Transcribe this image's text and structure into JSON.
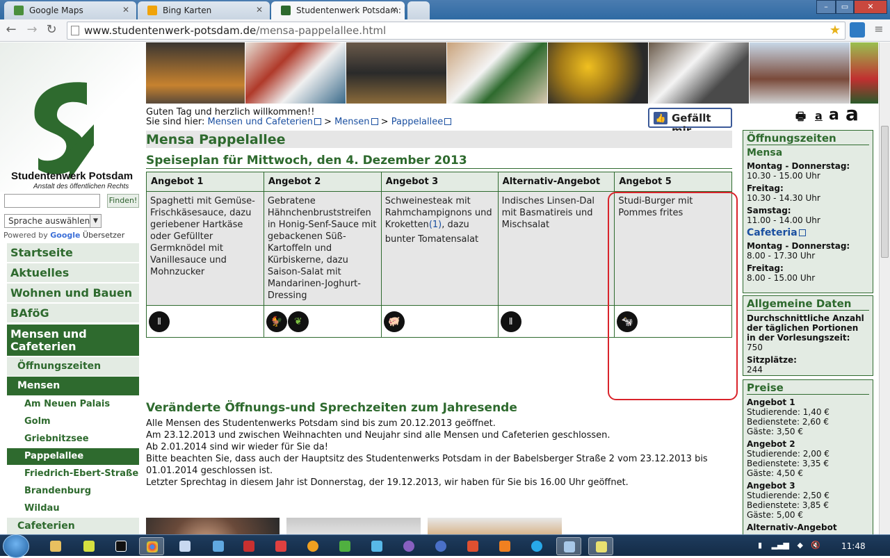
{
  "browser": {
    "tabs": [
      {
        "title": "Google Maps",
        "active": false,
        "favicon_color": "#4a8f3c"
      },
      {
        "title": "Bing Karten",
        "active": false,
        "favicon_color": "#f0a30a"
      },
      {
        "title": "Studentenwerk Potsdam: M",
        "active": true,
        "favicon_color": "#2e6a2e"
      }
    ],
    "url_host": "www.studentenwerk-potsdam.de",
    "url_path": "/mensa-pappelallee.html",
    "controls": {
      "minimize": "–",
      "maximize": "▭",
      "close": "✕"
    }
  },
  "sidebar": {
    "brand": "Studentenwerk Potsdam",
    "brand_sub": "Anstalt des öffentlichen Rechts",
    "search_button": "Finden!",
    "search_value": "",
    "language_select": "Sprache auswählen",
    "powered_by": "Powered by",
    "google": "Google",
    "translator": "Übersetzer",
    "main_nav": [
      {
        "label": "Startseite",
        "active": false
      },
      {
        "label": "Aktuelles",
        "active": false
      },
      {
        "label": "Wohnen und Bauen",
        "active": false
      },
      {
        "label": "BAföG",
        "active": false
      },
      {
        "label": "Mensen und Cafeterien",
        "active": true
      }
    ],
    "sub_nav": [
      {
        "label": "Öffnungszeiten",
        "active": false
      },
      {
        "label": "Mensen",
        "active": true
      }
    ],
    "mensen_nav": [
      {
        "label": "Am Neuen Palais",
        "active": false
      },
      {
        "label": "Golm",
        "active": false
      },
      {
        "label": "Griebnitzsee",
        "active": false
      },
      {
        "label": "Pappelallee",
        "active": true
      },
      {
        "label": "Friedrich-Ebert-Straße",
        "active": false
      },
      {
        "label": "Brandenburg",
        "active": false
      },
      {
        "label": "Wildau",
        "active": false
      }
    ],
    "cafeterien": "Cafeterien"
  },
  "main": {
    "greeting": "Guten Tag und herzlich willkommen!!",
    "breadcrumb_prefix": "Sie sind hier:",
    "breadcrumb": [
      "Mensen und Cafeterien",
      "Mensen",
      "Pappelallee"
    ],
    "breadcrumb_sep": ">",
    "like_button": "Gefällt mir",
    "page_title": "Mensa Pappelallee",
    "menu_heading": "Speiseplan für Mittwoch, den 4. Dezember 2013",
    "menu": [
      {
        "header": "Angebot 1",
        "description": "Spaghetti mit Gemüse-Frischkäsesauce, dazu geriebener Hartkäse oder Gefüllter Germknödel mit Vanillesauce und Mohnzucker",
        "icons": [
          "vegetarian-icon"
        ]
      },
      {
        "header": "Angebot 2",
        "description": "Gebratene Hähnchenbruststreifen in Honig-Senf-Sauce mit gebackenen Süß-Kartoffeln und Kürbiskerne, dazu Saison-Salat mit Mandarinen-Joghurt-Dressing",
        "icons": [
          "poultry-icon",
          "vegan-icon"
        ]
      },
      {
        "header": "Angebot 3",
        "description": "Schweinesteak mit Rahmchampignons und Kroketten",
        "ref": "(1)",
        "description_after": ", dazu",
        "description_2": "bunter Tomatensalat",
        "icons": [
          "pork-icon"
        ]
      },
      {
        "header": "Alternativ-Angebot",
        "description": "Indisches Linsen-Dal mit Basmatireis und Mischsalat",
        "icons": [
          "vegetarian-icon"
        ]
      },
      {
        "header": "Angebot 5",
        "description": "Studi-Burger mit Pommes frites",
        "icons": [
          "beef-icon"
        ]
      }
    ],
    "notice_title": "Veränderte Öffnungs-und Sprechzeiten zum Jahresende",
    "notice_lines": [
      "Alle Mensen des Studentenwerks Potsdam sind bis zum 20.12.2013 geöffnet.",
      "Am 23.12.2013 und zwischen Weihnachten und Neujahr sind alle Mensen und Cafeterien geschlossen.",
      "Ab 2.01.2014 sind wir wieder für Sie da!",
      "Bitte beachten Sie, dass auch der Hauptsitz des Studentenwerks Potsdam in der Babelsberger Straße 2 vom 23.12.2013 bis 01.01.2014 geschlossen ist.",
      "Letzter Sprechtag in diesem Jahr ist Donnerstag, der 19.12.2013, wir haben für Sie bis 16.00 Uhr geöffnet."
    ]
  },
  "right": {
    "font_tools": [
      "a",
      "a",
      "a"
    ],
    "hours_title": "Öffnungszeiten",
    "mensa_label": "Mensa",
    "mensa_hours": [
      {
        "day": "Montag - Donnerstag:",
        "time": "10.30 - 15.00 Uhr"
      },
      {
        "day": "Freitag:",
        "time": "10.30 - 14.30 Uhr"
      },
      {
        "day": "Samstag:",
        "time": "11.00 - 14.00 Uhr"
      }
    ],
    "cafeteria_label": "Cafeteria",
    "cafeteria_hours": [
      {
        "day": "Montag - Donnerstag:",
        "time": "8.00 - 17.30 Uhr"
      },
      {
        "day": "Freitag:",
        "time": "8.00 - 15.00 Uhr"
      }
    ],
    "general_title": "Allgemeine Daten",
    "portions_label": "Durchschnittliche Anzahl der täglichen Portionen in der Vorlesungszeit:",
    "portions_value": "750",
    "seats_label": "Sitzplätze:",
    "seats_value": "244",
    "prices_title": "Preise",
    "prices": [
      {
        "name": "Angebot 1",
        "lines": [
          "Studierende: 1,40 €",
          "Bedienstete: 2,60 €",
          "Gäste: 3,50 €"
        ]
      },
      {
        "name": "Angebot 2",
        "lines": [
          "Studierende: 2,00 €",
          "Bedienstete: 3,35 €",
          "Gäste: 4,50 €"
        ]
      },
      {
        "name": "Angebot 3",
        "lines": [
          "Studierende: 2,50 €",
          "Bedienstete: 3,85 €",
          "Gäste: 5,00 €"
        ]
      },
      {
        "name": "Alternativ-Angebot",
        "lines": []
      }
    ]
  },
  "taskbar": {
    "clock": "11:48"
  },
  "colors": {
    "brand_green": "#2e6a2e",
    "light_green": "#e3ebe3",
    "link_blue": "#1a4fa0",
    "highlight_red": "#d9232a"
  }
}
